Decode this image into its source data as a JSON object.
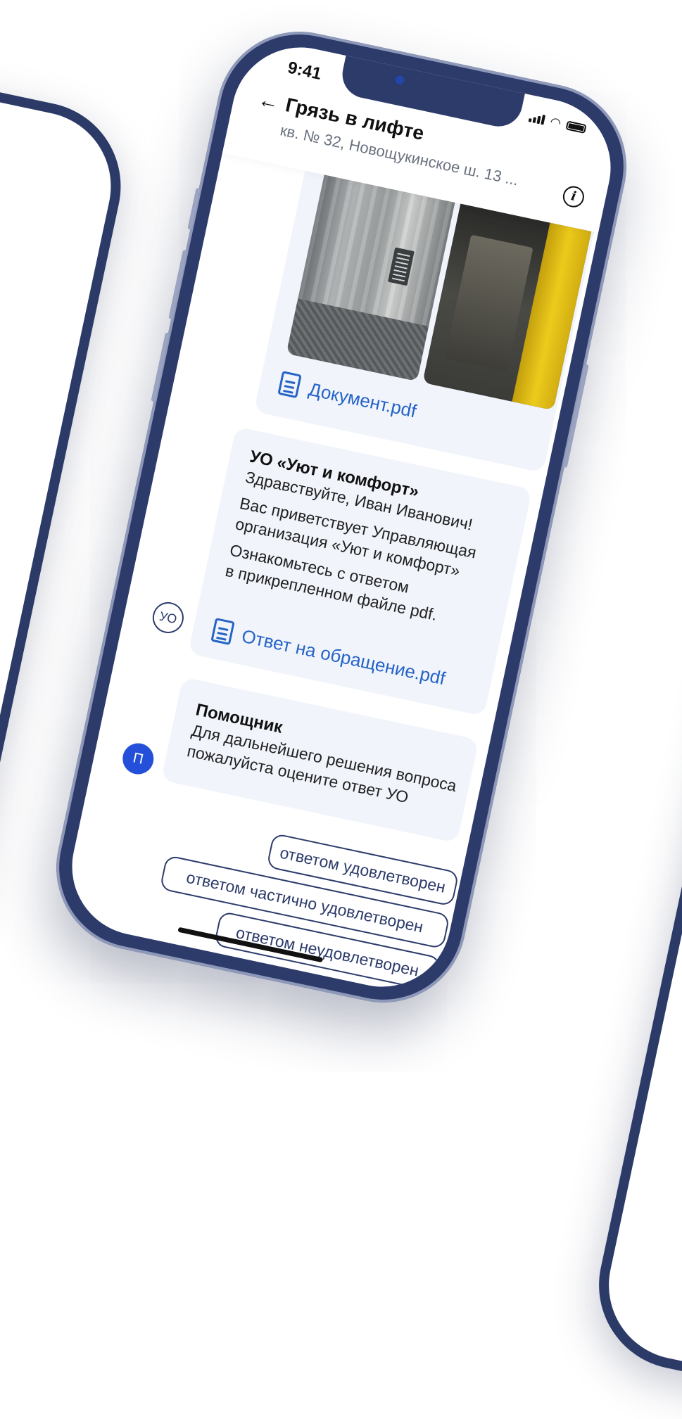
{
  "status_bar": {
    "time": "9:41"
  },
  "header": {
    "title": "Грязь в лифте",
    "subtitle": "кв. № 32, Новощукинское ш. 13 ..."
  },
  "messages": {
    "attachment": {
      "document": "Документ.pdf"
    },
    "uo": {
      "avatar": "УО",
      "sender": "УО «Уют и комфорт»",
      "lines": [
        "Здравствуйте, Иван Иванович!",
        "Вас приветствует Управляющая",
        "организация «Уют и комфорт»",
        "Ознакомьтесь с ответом",
        "в прикрепленном файле pdf."
      ],
      "document": "Ответ на обращение.pdf"
    },
    "assistant": {
      "avatar": "П",
      "sender": "Помощник",
      "lines": [
        "Для дальнейшего решения вопроса",
        "пожалуйста оцените ответ УО"
      ]
    }
  },
  "options": [
    "ответом удовлетворен",
    "ответом частично удовлетворен",
    "ответом неудовлетворен"
  ],
  "colors": {
    "frame": "#2d3b6b",
    "bubble": "#f1f5fb",
    "link": "#2563c7",
    "avatar_filled": "#2450d9"
  }
}
